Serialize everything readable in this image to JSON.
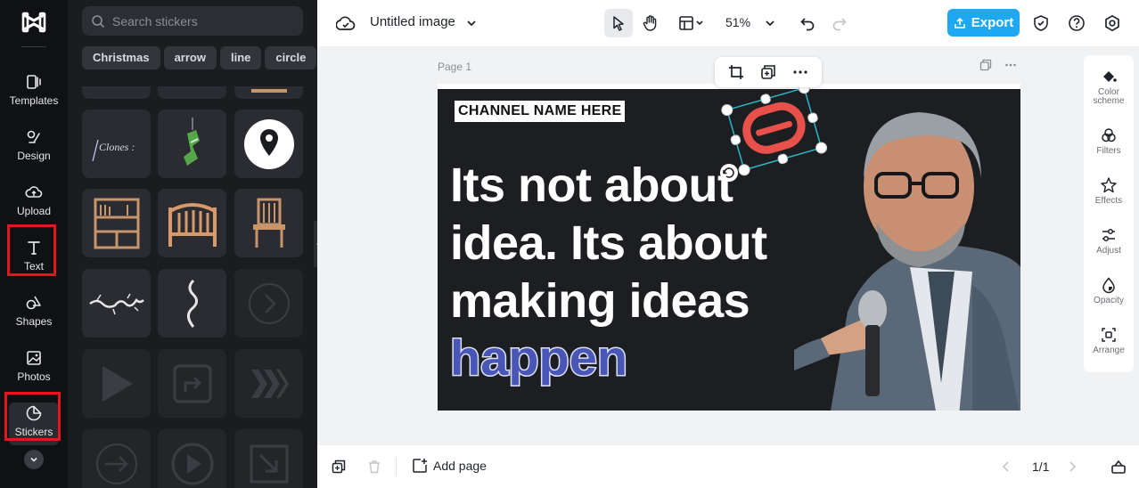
{
  "rail": {
    "items": [
      {
        "label": "Templates"
      },
      {
        "label": "Design"
      },
      {
        "label": "Upload"
      },
      {
        "label": "Text"
      },
      {
        "label": "Shapes"
      },
      {
        "label": "Photos"
      },
      {
        "label": "Stickers"
      }
    ]
  },
  "panel": {
    "search_placeholder": "Search stickers",
    "chips": [
      "Christmas",
      "arrow",
      "line",
      "circle"
    ],
    "clones_text": "Clones :"
  },
  "topbar": {
    "file_title": "Untitled image",
    "zoom": "51%",
    "export_label": "Export"
  },
  "canvas": {
    "page_label": "Page 1",
    "channel_name": "CHANNEL NAME HERE",
    "headline_lines": [
      "Its not about",
      "idea. Its about",
      "making ideas"
    ],
    "highlight_word": "happen"
  },
  "props": {
    "items": [
      {
        "label": "Color scheme"
      },
      {
        "label": "Filters"
      },
      {
        "label": "Effects"
      },
      {
        "label": "Adjust"
      },
      {
        "label": "Opacity"
      },
      {
        "label": "Arrange"
      }
    ]
  },
  "bottombar": {
    "add_page_label": "Add page",
    "pager": "1/1"
  },
  "colors": {
    "accent": "#1ea8f2",
    "highlight_box": "#e5171e",
    "sticker_red": "#e8504a",
    "selection": "#2bb7c9"
  }
}
